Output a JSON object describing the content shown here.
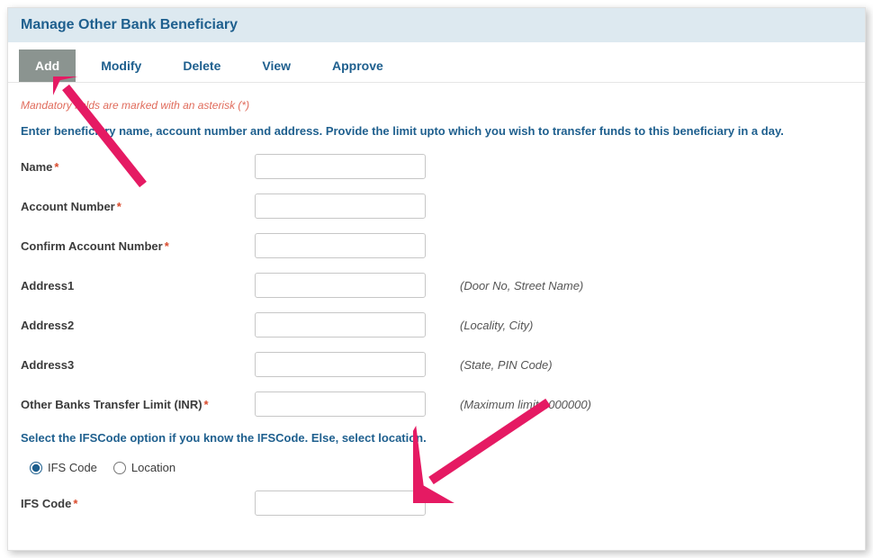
{
  "header": {
    "title": "Manage Other Bank Beneficiary"
  },
  "tabs": {
    "add": "Add",
    "modify": "Modify",
    "delete": "Delete",
    "view": "View",
    "approve": "Approve"
  },
  "notes": {
    "mandatory": "Mandatory fields are marked with an asterisk (*)",
    "instruction": "Enter beneficiary name, account number and address. Provide the limit upto which you wish to transfer funds to this beneficiary in a day.",
    "ifsc_select": "Select the IFSCode option if you know the IFSCode. Else, select location."
  },
  "fields": {
    "name": {
      "label": "Name"
    },
    "account": {
      "label": "Account Number"
    },
    "confirm": {
      "label": "Confirm Account Number"
    },
    "addr1": {
      "label": "Address1",
      "hint": "(Door No, Street Name)"
    },
    "addr2": {
      "label": "Address2",
      "hint": "(Locality, City)"
    },
    "addr3": {
      "label": "Address3",
      "hint": "(State, PIN Code)"
    },
    "limit": {
      "label": "Other Banks Transfer Limit (INR)",
      "hint": "(Maximum limit:1000000)"
    },
    "ifsc": {
      "label": "IFS Code"
    }
  },
  "radio": {
    "ifs": "IFS Code",
    "loc": "Location"
  }
}
